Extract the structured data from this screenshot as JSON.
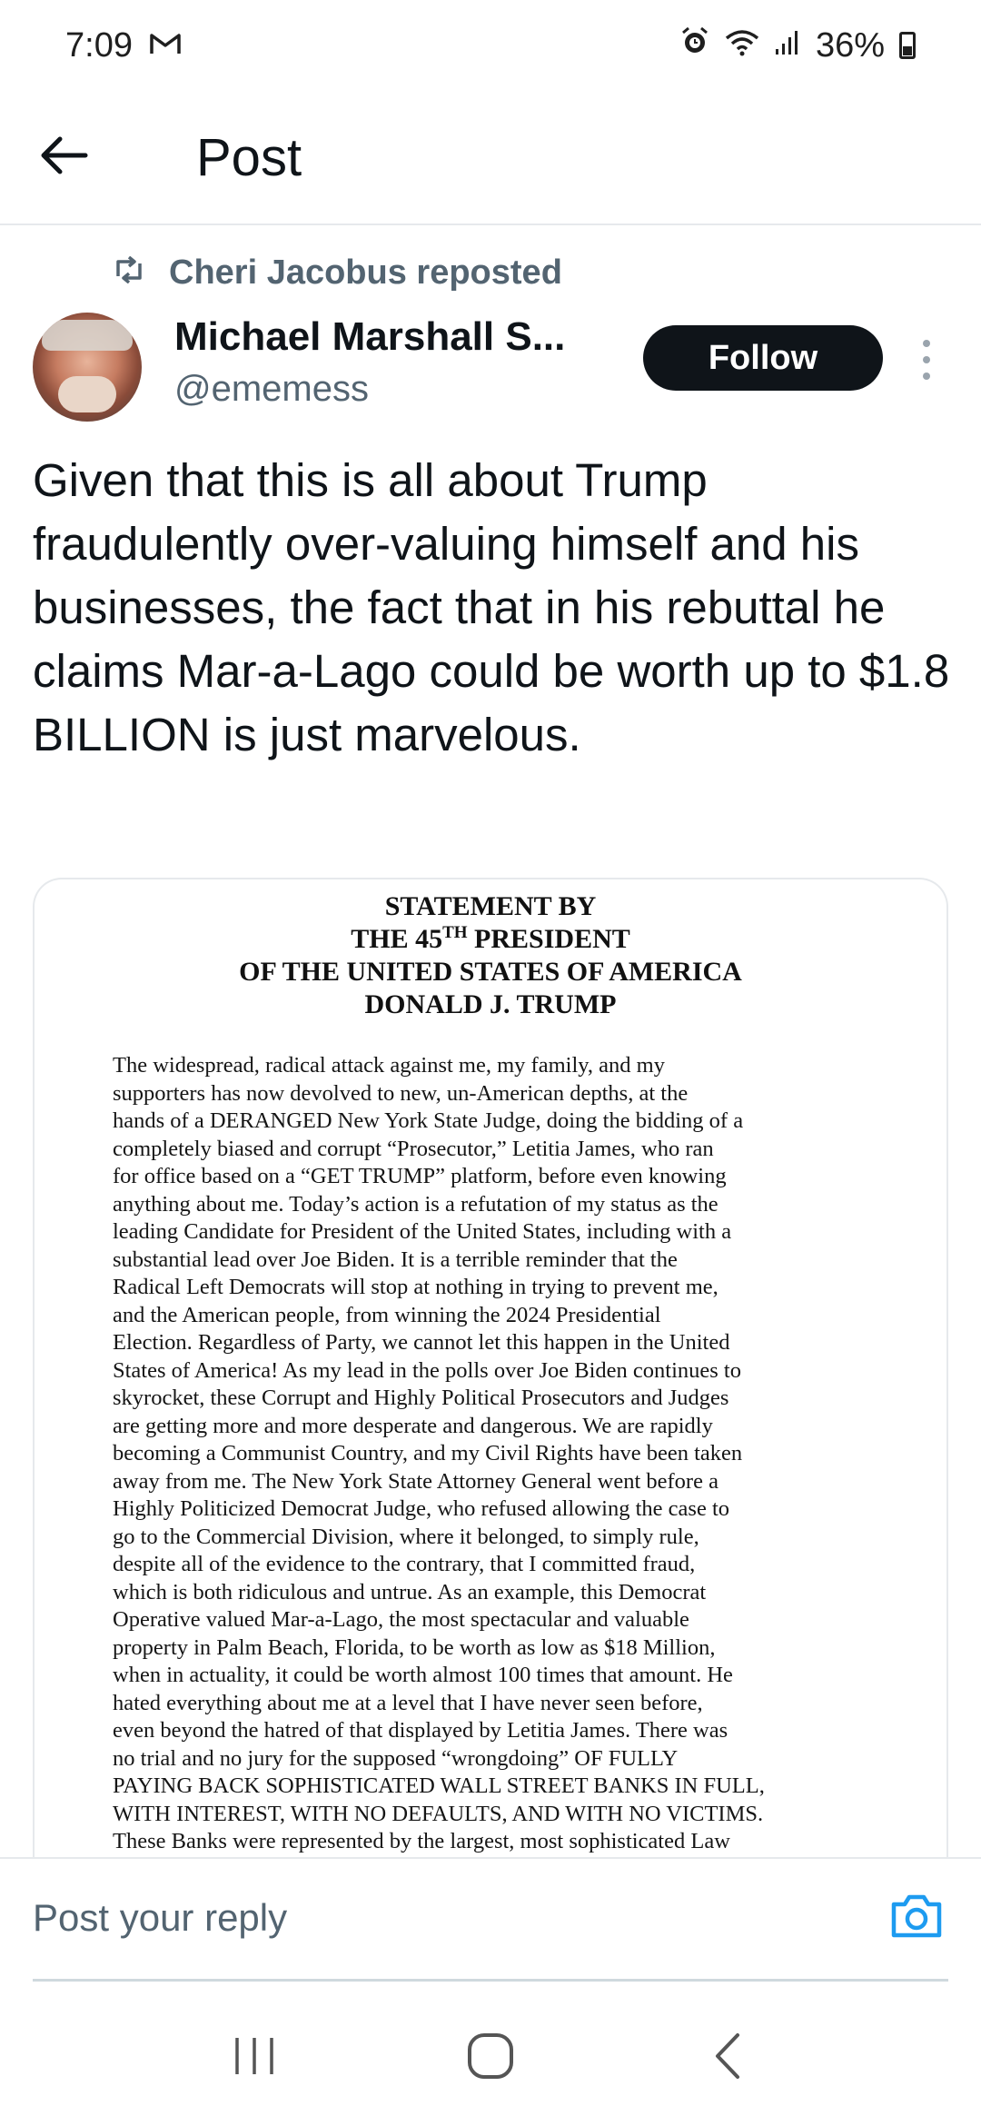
{
  "status_bar": {
    "time": "7:09",
    "battery": "36%",
    "icons": [
      "gmail-icon",
      "alarm-icon",
      "wifi-icon",
      "signal-icon",
      "battery-icon"
    ]
  },
  "header": {
    "title": "Post",
    "back_icon": "arrow-left-icon"
  },
  "repost": {
    "text": "Cheri Jacobus reposted",
    "icon": "repost-icon"
  },
  "author": {
    "name": "Michael Marshall S...",
    "handle": "@ememess"
  },
  "follow_label": "Follow",
  "post_text": "Given that this is all about Trump fraudulently over-valuing himself and his businesses, the fact that in his rebuttal he claims Mar-a-Lago could be worth up to $1.8 BILLION is just marvelous.",
  "statement": {
    "line1": "STATEMENT BY",
    "line2_pre": "THE 45",
    "line2_sup": "TH",
    "line2_post": " PRESIDENT",
    "line3": "OF THE UNITED STATES OF AMERICA",
    "line4": "DONALD J. TRUMP",
    "body": [
      "The widespread, radical attack against me, my family, and my",
      "supporters has now devolved to new, un-American depths, at the",
      "hands of a DERANGED New York State Judge, doing the bidding of a",
      "completely biased and corrupt “Prosecutor,” Letitia James, who ran",
      "for office based on a “GET TRUMP” platform, before even knowing",
      "anything about me. Today’s action is a refutation of my status as the",
      "leading Candidate for President of the United States, including with a",
      "substantial lead over Joe Biden. It is a terrible reminder that the",
      "Radical Left Democrats will stop at nothing in trying to prevent me,",
      "and the American people, from winning the 2024 Presidential",
      "Election. Regardless of Party, we cannot let this happen in the United",
      "States of America! As my lead in the polls over Joe Biden continues to",
      "skyrocket, these Corrupt and Highly Political Prosecutors and Judges",
      "are getting more and more desperate and dangerous. We are rapidly",
      "becoming a Communist Country, and my Civil Rights have been taken",
      "away from me. The New York State Attorney General went before a",
      "Highly Politicized Democrat Judge, who refused allowing the case to",
      "go to the Commercial Division, where it belonged, to simply rule,",
      "despite all of the evidence to the contrary, that I committed fraud,",
      "which is both ridiculous and untrue. As an example, this Democrat",
      "Operative valued Mar-a-Lago, the most spectacular and valuable",
      "property in Palm Beach, Florida, to be worth as low as $18 Million,",
      "when in actuality, it could be worth almost 100 times that amount. He",
      "hated everything about me at a level that I have never seen before,",
      "even beyond the hatred of that displayed by Letitia James. There was",
      "no trial and no jury for the supposed “wrongdoing” OF FULLY",
      "PAYING BACK SOPHISTICATED WALL STREET BANKS IN FULL,",
      "WITH INTEREST, WITH NO DEFAULTS, AND WITH NO VICTIMS.",
      "These Banks were represented by the largest, most sophisticated Law"
    ]
  },
  "reply": {
    "placeholder": "Post your reply",
    "camera_icon": "camera-icon"
  },
  "nav_bar": {
    "icons": [
      "recents-icon",
      "home-icon",
      "back-icon"
    ]
  },
  "colors": {
    "text_primary": "#0f1419",
    "text_secondary": "#536471",
    "follow_bg": "#0f1419",
    "accent": "#1d9bf0",
    "divider": "#e6e9ec"
  }
}
